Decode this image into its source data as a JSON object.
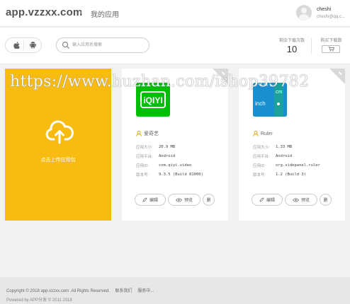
{
  "header": {
    "logo": "app.vzzxx.com",
    "breadcrumb_sep": "›",
    "breadcrumb": "我的应用",
    "user_name": "cheshi",
    "user_email": "cheshi@qq.c..."
  },
  "toolbar": {
    "search_placeholder": "输入应用名搜索",
    "download_label": "剩余下载次数",
    "download_count": "10",
    "buy_label": "购买下载数"
  },
  "upload": {
    "label": "点击上传应用包"
  },
  "apps": [
    {
      "name": "爱奇艺",
      "icon": "iqiyi-app-icon",
      "icon_text": "iQIYI",
      "fields": [
        {
          "label": "应用大小:",
          "value": "20.9 MB"
        },
        {
          "label": "应用平台:",
          "value": "Android"
        },
        {
          "label": "应用ID:",
          "value": "com.qiyi.video"
        },
        {
          "label": "版本号:",
          "value": "9.3.5 (Build 81000)"
        }
      ]
    },
    {
      "name": "Ruler",
      "icon": "ruler-app-icon",
      "icon_text_1": "inch",
      "icon_text_2": "cm",
      "fields": [
        {
          "label": "应用大小:",
          "value": "1.33 MB"
        },
        {
          "label": "应用平台:",
          "value": "Android"
        },
        {
          "label": "应用ID:",
          "value": "org.sidepanel.ruler"
        },
        {
          "label": "版本号:",
          "value": "1.2 (Build 3)"
        }
      ]
    }
  ],
  "actions": {
    "edit": "编辑",
    "preview": "预览",
    "delete": "删"
  },
  "footer": {
    "copyright": "Copyright © 2018 app.vzzxx.com .All Rights Reserved.",
    "contact": "联系我们",
    "service": "服务中...",
    "powered": "Powered by APP分发 © 2011 2018"
  },
  "watermark": "https://www.huzhan.com/ishop39782",
  "colors": {
    "accent": "#f7bb12",
    "iqiyi_green": "#00be06",
    "ruler_blue": "#1a8fd0"
  }
}
